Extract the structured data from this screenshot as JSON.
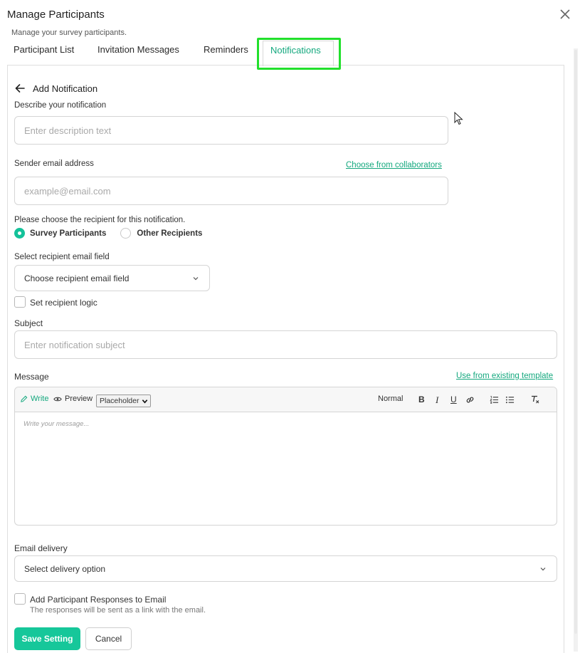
{
  "dialog": {
    "title": "Manage Participants",
    "subtitle": "Manage your survey participants."
  },
  "tabs": [
    {
      "label": "Participant List",
      "active": false
    },
    {
      "label": "Invitation Messages",
      "active": false
    },
    {
      "label": "Reminders",
      "active": false
    },
    {
      "label": "Notifications",
      "active": true
    }
  ],
  "form": {
    "heading": "Add Notification",
    "description": {
      "label": "Describe your notification",
      "placeholder": "Enter description text",
      "value": ""
    },
    "sender": {
      "label": "Sender email address",
      "link": "Choose from collaborators",
      "placeholder": "example@email.com",
      "value": ""
    },
    "recipient": {
      "question": "Please choose the recipient for this notification.",
      "options": [
        {
          "label": "Survey Participants",
          "selected": true
        },
        {
          "label": "Other Recipients",
          "selected": false
        }
      ]
    },
    "recipient_field": {
      "label": "Select recipient email field",
      "value": "Choose recipient email field"
    },
    "recipient_logic": {
      "label": "Set recipient logic",
      "checked": false
    },
    "subject": {
      "label": "Subject",
      "placeholder": "Enter notification subject",
      "value": ""
    },
    "message": {
      "label": "Message",
      "link": "Use from existing template",
      "toolbar": {
        "write": "Write",
        "preview": "Preview",
        "placeholder_select": "Placeholder",
        "text_style": "Normal"
      },
      "placeholder": "Write your message..."
    },
    "email_delivery": {
      "label": "Email delivery",
      "value": "Select delivery option"
    },
    "add_responses": {
      "label": "Add Participant Responses to Email",
      "hint": "The responses will be sent as a link with the email.",
      "checked": false
    }
  },
  "actions": {
    "save": "Save Setting",
    "cancel": "Cancel"
  },
  "colors": {
    "accent": "#14a87e",
    "primary_button": "#16c79a",
    "tab_highlight": "#22e02c"
  },
  "icons": {
    "close": "close-icon",
    "back": "arrow-left-icon",
    "write": "pencil-icon",
    "preview": "eye-icon",
    "chevron": "chevron-down-icon"
  }
}
